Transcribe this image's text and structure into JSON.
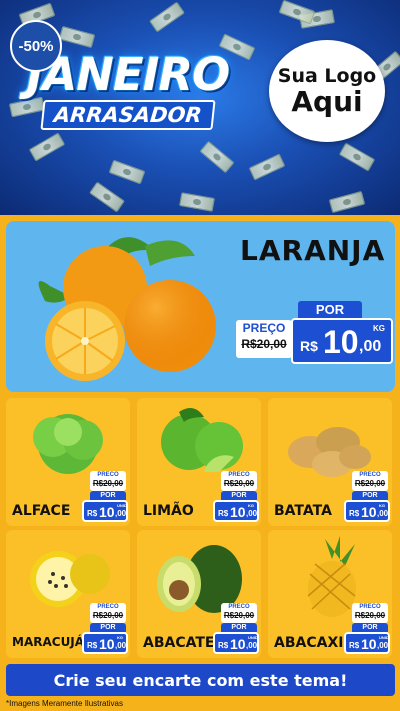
{
  "header": {
    "title_line1": "JANEIRO",
    "title_line2": "ARRASADOR",
    "logo_line1": "Sua Logo",
    "logo_line2": "Aqui"
  },
  "hero": {
    "discount": "-50%",
    "name": "LARANJA",
    "por_label": "POR",
    "preco_label": "PREÇO",
    "old_price": "R$20,00",
    "currency": "R$",
    "price_int": "10",
    "price_dec": ",00",
    "unit": "KG"
  },
  "products": [
    {
      "name": "ALFACE",
      "preco_label": "PRECO",
      "old_price": "R$20,00",
      "por_label": "POR",
      "currency": "R$",
      "price_int": "10",
      "price_dec": ",00",
      "unit": "UNID"
    },
    {
      "name": "LIMÃO",
      "preco_label": "PRECO",
      "old_price": "R$20,00",
      "por_label": "POR",
      "currency": "R$",
      "price_int": "10",
      "price_dec": ",00",
      "unit": "KG"
    },
    {
      "name": "BATATA",
      "preco_label": "PRECO",
      "old_price": "R$20,00",
      "por_label": "POR",
      "currency": "R$",
      "price_int": "10",
      "price_dec": ",00",
      "unit": "KG"
    },
    {
      "name": "MARACUJÁ",
      "preco_label": "PRECO",
      "old_price": "R$20,00",
      "por_label": "POR",
      "currency": "R$",
      "price_int": "10",
      "price_dec": ",00",
      "unit": "KG"
    },
    {
      "name": "ABACATE",
      "preco_label": "PRECO",
      "old_price": "R$20,00",
      "por_label": "POR",
      "currency": "R$",
      "price_int": "10",
      "price_dec": ",00",
      "unit": "UNID"
    },
    {
      "name": "ABACAXI",
      "preco_label": "PRECO",
      "old_price": "R$20,00",
      "por_label": "POR",
      "currency": "R$",
      "price_int": "10",
      "price_dec": ",00",
      "unit": "UNID"
    }
  ],
  "cta": "Crie seu encarte com este tema!",
  "disclaimer": "*Imagens Meramente Ilustrativas",
  "colors": {
    "blue": "#1d4fd3",
    "yellow": "#fbbf27",
    "sky": "#5fb6ef"
  }
}
